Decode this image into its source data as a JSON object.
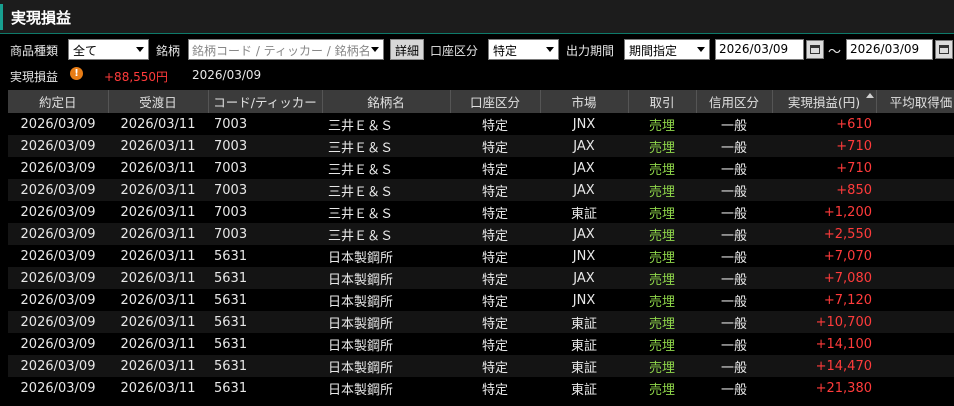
{
  "window": {
    "title": "実現損益"
  },
  "filters": {
    "product_label": "商品種類",
    "product_value": "全て",
    "symbol_label": "銘柄",
    "symbol_placeholder": "銘柄コード / ティッカー / 銘柄名",
    "detail_button": "詳細",
    "account_label": "口座区分",
    "account_value": "特定",
    "period_label": "出力期間",
    "period_value": "期間指定",
    "date_from": "2026/03/09",
    "tilde": "～",
    "date_to": "2026/03/09"
  },
  "summary": {
    "label": "実現損益",
    "warning_icon": "!",
    "total": "+88,550円",
    "date": "2026/03/09"
  },
  "table": {
    "headers": [
      "約定日",
      "受渡日",
      "コード/ティッカー",
      "銘柄名",
      "口座区分",
      "市場",
      "取引",
      "信用区分",
      "実現損益(円)",
      "平均取得価"
    ],
    "rows": [
      [
        "2026/03/09",
        "2026/03/11",
        "7003",
        "三井Ｅ＆Ｓ",
        "特定",
        "JNX",
        "売埋",
        "一般",
        "+610"
      ],
      [
        "2026/03/09",
        "2026/03/11",
        "7003",
        "三井Ｅ＆Ｓ",
        "特定",
        "JAX",
        "売埋",
        "一般",
        "+710"
      ],
      [
        "2026/03/09",
        "2026/03/11",
        "7003",
        "三井Ｅ＆Ｓ",
        "特定",
        "JAX",
        "売埋",
        "一般",
        "+710"
      ],
      [
        "2026/03/09",
        "2026/03/11",
        "7003",
        "三井Ｅ＆Ｓ",
        "特定",
        "JAX",
        "売埋",
        "一般",
        "+850"
      ],
      [
        "2026/03/09",
        "2026/03/11",
        "7003",
        "三井Ｅ＆Ｓ",
        "特定",
        "東証",
        "売埋",
        "一般",
        "+1,200"
      ],
      [
        "2026/03/09",
        "2026/03/11",
        "7003",
        "三井Ｅ＆Ｓ",
        "特定",
        "JAX",
        "売埋",
        "一般",
        "+2,550"
      ],
      [
        "2026/03/09",
        "2026/03/11",
        "5631",
        "日本製鋼所",
        "特定",
        "JNX",
        "売埋",
        "一般",
        "+7,070"
      ],
      [
        "2026/03/09",
        "2026/03/11",
        "5631",
        "日本製鋼所",
        "特定",
        "JAX",
        "売埋",
        "一般",
        "+7,080"
      ],
      [
        "2026/03/09",
        "2026/03/11",
        "5631",
        "日本製鋼所",
        "特定",
        "JNX",
        "売埋",
        "一般",
        "+7,120"
      ],
      [
        "2026/03/09",
        "2026/03/11",
        "5631",
        "日本製鋼所",
        "特定",
        "東証",
        "売埋",
        "一般",
        "+10,700"
      ],
      [
        "2026/03/09",
        "2026/03/11",
        "5631",
        "日本製鋼所",
        "特定",
        "東証",
        "売埋",
        "一般",
        "+14,100"
      ],
      [
        "2026/03/09",
        "2026/03/11",
        "5631",
        "日本製鋼所",
        "特定",
        "東証",
        "売埋",
        "一般",
        "+14,470"
      ],
      [
        "2026/03/09",
        "2026/03/11",
        "5631",
        "日本製鋼所",
        "特定",
        "東証",
        "売埋",
        "一般",
        "+21,380"
      ]
    ]
  },
  "colors": {
    "gain": "#ff3b3b",
    "sell": "#8fd64a",
    "accent": "#18a090",
    "warning": "#e87d16"
  },
  "icons": {
    "calendar": "calendar-icon",
    "warning": "warning-icon",
    "sort": "sort-ascending-icon",
    "dropdown": "chevron-down-icon"
  }
}
